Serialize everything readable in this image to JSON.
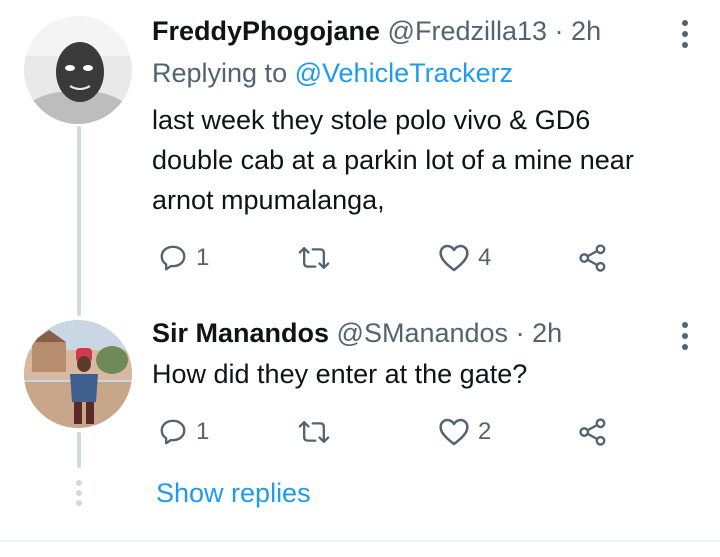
{
  "tweets": [
    {
      "display_name": "FreddyPhogojane",
      "handle": "@Fredzilla13",
      "separator": "·",
      "time": "2h",
      "replying_prefix": "Replying to",
      "replying_to": "@VehicleTrackerz",
      "text_lines": [
        "last week they stole polo vivo & GD6",
        "double cab at a parkin lot of a mine near",
        "arnot mpumalanga,"
      ],
      "reply_count": "1",
      "retweet_count": "",
      "like_count": "4"
    },
    {
      "display_name": "Sir Manandos",
      "handle": "@SManandos",
      "separator": "·",
      "time": "2h",
      "text_lines": [
        "How did they enter at the gate?"
      ],
      "reply_count": "1",
      "retweet_count": "",
      "like_count": "2"
    }
  ],
  "show_replies_label": "Show replies",
  "colors": {
    "accent": "#1d9bf0",
    "secondary_text": "#536471",
    "thread_line": "#cfd9de"
  },
  "icons": [
    "more-icon",
    "reply-icon",
    "retweet-icon",
    "like-icon",
    "share-icon"
  ]
}
